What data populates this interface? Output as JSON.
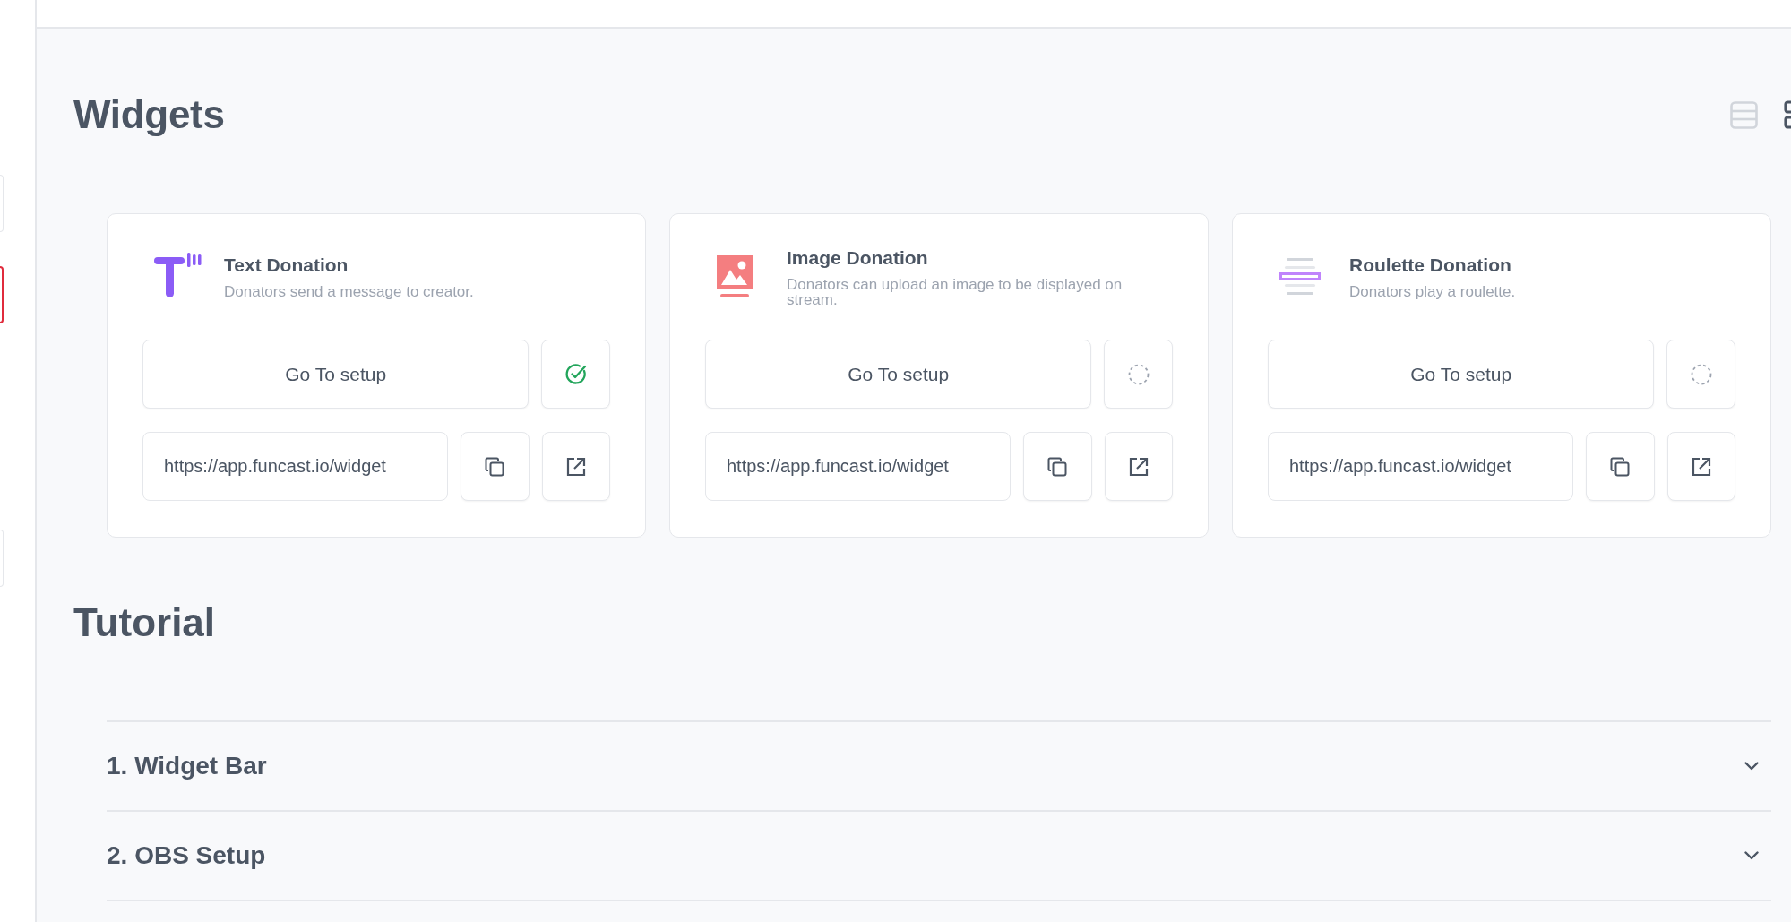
{
  "sidebar": {
    "items": [
      {
        "selected": false
      },
      {
        "selected": true
      },
      {
        "selected": false
      }
    ]
  },
  "widgets": {
    "title": "Widgets",
    "view_modes": [
      {
        "kind": "list",
        "selected": false
      },
      {
        "kind": "grid",
        "selected": true
      }
    ],
    "cards": [
      {
        "kind": "text",
        "title": "Text Donation",
        "description": "Donators send a message to creator.",
        "button": "Go To setup",
        "complete": true,
        "url": "https://app.funcast.io/widget"
      },
      {
        "kind": "image",
        "title": "Image Donation",
        "description": "Donators can upload an image to be displayed on stream.",
        "button": "Go To setup",
        "complete": false,
        "url": "https://app.funcast.io/widget"
      },
      {
        "kind": "roulette",
        "title": "Roulette Donation",
        "description": "Donators play a roulette.",
        "button": "Go To setup",
        "complete": false,
        "url": "https://app.funcast.io/widget"
      }
    ]
  },
  "tutorial": {
    "title": "Tutorial",
    "items": [
      {
        "title": "1. Widget Bar",
        "expanded": false
      },
      {
        "title": "2. OBS Setup",
        "expanded": false
      }
    ]
  }
}
